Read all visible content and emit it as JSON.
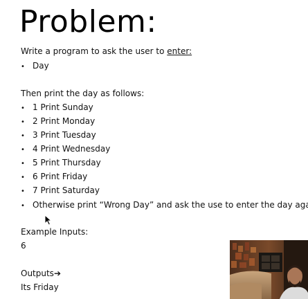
{
  "slide": {
    "title": "Problem:",
    "intro_prefix": "Write a program to ask the user to ",
    "intro_emphasis": "enter:",
    "inputs_list": [
      "Day"
    ],
    "print_intro": "Then print the day as follows:",
    "rules": [
      "1 Print Sunday",
      "2 Print Monday",
      "3 Print Tuesday",
      "4 Print Wednesday",
      "5 Print Thursday",
      "6 Print Friday",
      "7 Print Saturday",
      "Otherwise print “Wrong Day” and ask the use to enter the day again."
    ],
    "example_inputs_label": "Example Inputs:",
    "example_input_value": "6",
    "outputs_label": "Outputs",
    "outputs_arrow": "➔",
    "example_output_value": "Its Friday",
    "bullet_symbol": "•"
  },
  "webcam": {
    "icon": "presenter-video-feed"
  },
  "cursor": {
    "icon": "mouse-pointer-icon"
  }
}
